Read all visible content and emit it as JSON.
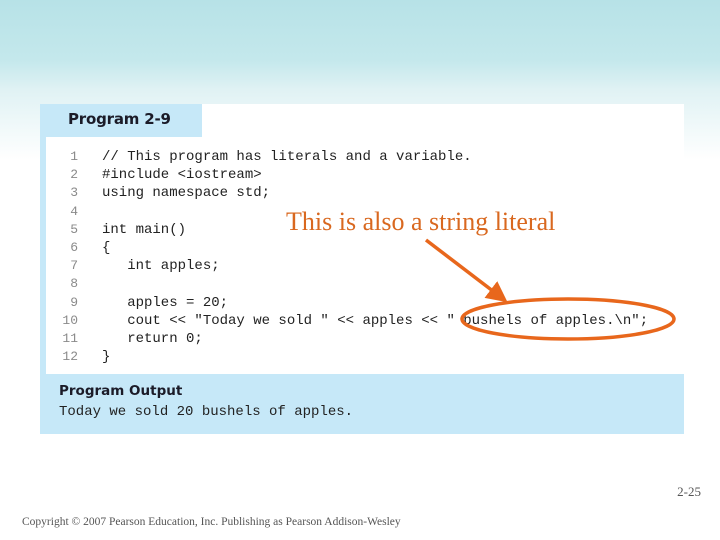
{
  "program": {
    "title": "Program 2-9",
    "lines": [
      {
        "no": "1",
        "text": "// This program has literals and a variable."
      },
      {
        "no": "2",
        "text": "#include <iostream>"
      },
      {
        "no": "3",
        "text": "using namespace std;"
      },
      {
        "no": "4",
        "text": ""
      },
      {
        "no": "5",
        "text": "int main()"
      },
      {
        "no": "6",
        "text": "{"
      },
      {
        "no": "7",
        "text": "   int apples;"
      },
      {
        "no": "8",
        "text": ""
      },
      {
        "no": "9",
        "text": "   apples = 20;"
      },
      {
        "no": "10",
        "text": "   cout << \"Today we sold \" << apples << \" bushels of apples.\\n\";"
      },
      {
        "no": "11",
        "text": "   return 0;"
      },
      {
        "no": "12",
        "text": "}"
      }
    ]
  },
  "output": {
    "title": "Program Output",
    "text": "Today we sold 20 bushels of apples."
  },
  "annotation": {
    "text": "This is also a string literal",
    "color": "#e8671c"
  },
  "footer": {
    "page_number": "2-25",
    "copyright": "Copyright © 2007 Pearson Education, Inc. Publishing as Pearson Addison-Wesley"
  },
  "colors": {
    "panel_blue": "#c6e8f8",
    "annotation_orange": "#e8671c"
  }
}
